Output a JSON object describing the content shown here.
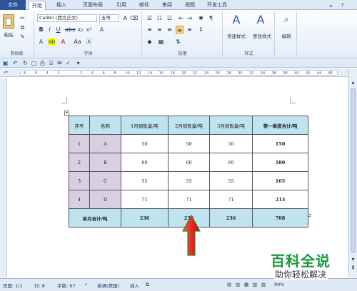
{
  "ribbon_tabs": {
    "file": "文件",
    "tabs": [
      "开始",
      "插入",
      "页面布局",
      "引用",
      "邮件",
      "审阅",
      "视图",
      "开发工具"
    ]
  },
  "ribbon": {
    "clipboard": {
      "paste": "粘贴",
      "label": "剪贴板"
    },
    "font": {
      "name": "Calibri (西文正文)",
      "size": "五号",
      "label": "字体"
    },
    "paragraph": {
      "label": "段落"
    },
    "styles": {
      "quick": "快速样式",
      "change": "更改样式",
      "label": "样式"
    },
    "editing": {
      "label": "编辑"
    }
  },
  "ruler": {
    "ticks": [
      "8",
      "6",
      "4",
      "2",
      "",
      "2",
      "4",
      "6",
      "8",
      "10",
      "12",
      "14",
      "16",
      "18",
      "20",
      "22",
      "24",
      "26",
      "28",
      "30",
      "32",
      "34",
      "36",
      "38",
      "40",
      "42",
      "44",
      "46"
    ]
  },
  "table": {
    "headers": [
      "序号",
      "名称",
      "1月销售量/吨",
      "2月销售量/吨",
      "3月销售量/吨",
      "第一季度合计/吨"
    ],
    "rows": [
      [
        "1",
        "A",
        "50",
        "50",
        "50",
        "150"
      ],
      [
        "2",
        "B",
        "60",
        "60",
        "60",
        "180"
      ],
      [
        "3",
        "C",
        "55",
        "55",
        "55",
        "165"
      ],
      [
        "4",
        "D",
        "71",
        "71",
        "71",
        "213"
      ]
    ],
    "footer": [
      "单月合计/吨",
      "236",
      "236",
      "236",
      "708"
    ]
  },
  "status": {
    "page": "页面: 1/1",
    "row": "行: 8",
    "words": "字数: 67",
    "lang": "英语(美国)",
    "mode": "插入",
    "zoom": "90%"
  },
  "watermark": {
    "title": "百科全说",
    "subtitle": "助你轻松解决"
  },
  "colors": {
    "accent": "#2b5797",
    "header_fill": "#bfe3ef",
    "name_fill": "#d9cfe3",
    "arrow": "#e02020"
  }
}
